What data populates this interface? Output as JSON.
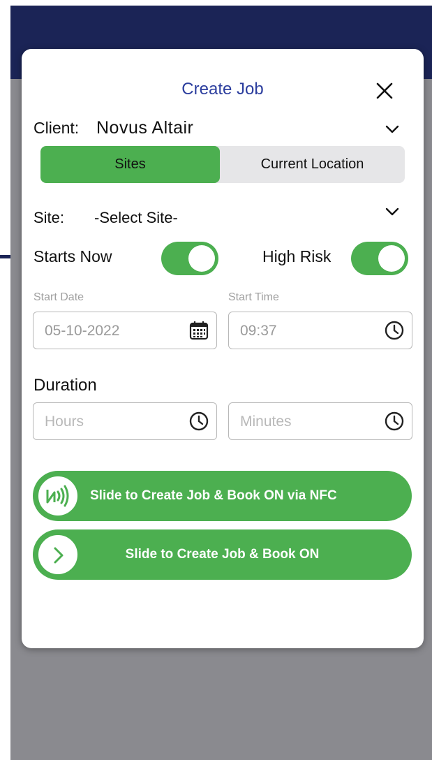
{
  "modal": {
    "title": "Create Job",
    "client_label": "Client:",
    "client_value": "Novus Altair",
    "segment": {
      "active": "Sites",
      "inactive": "Current Location"
    },
    "site_label": "Site:",
    "site_value": "-Select Site-",
    "starts_now": {
      "label": "Starts Now",
      "on": true
    },
    "high_risk": {
      "label": "High Risk",
      "on": true
    },
    "start_date": {
      "label": "Start Date",
      "value": "05-10-2022"
    },
    "start_time": {
      "label": "Start Time",
      "value": "09:37"
    },
    "duration": {
      "label": "Duration",
      "hours_placeholder": "Hours",
      "minutes_placeholder": "Minutes"
    },
    "slide_nfc": "Slide to Create Job & Book ON via NFC",
    "slide_book": "Slide to Create Job & Book ON"
  },
  "colors": {
    "accent_green": "#4caf50",
    "title_blue": "#2c3e9e",
    "header_navy": "#1b2456",
    "backdrop_gray": "#8a8a8f"
  },
  "icons": [
    "close-icon",
    "chevron-down-icon",
    "calendar-icon",
    "clock-icon",
    "nfc-icon",
    "chevron-right-icon"
  ]
}
